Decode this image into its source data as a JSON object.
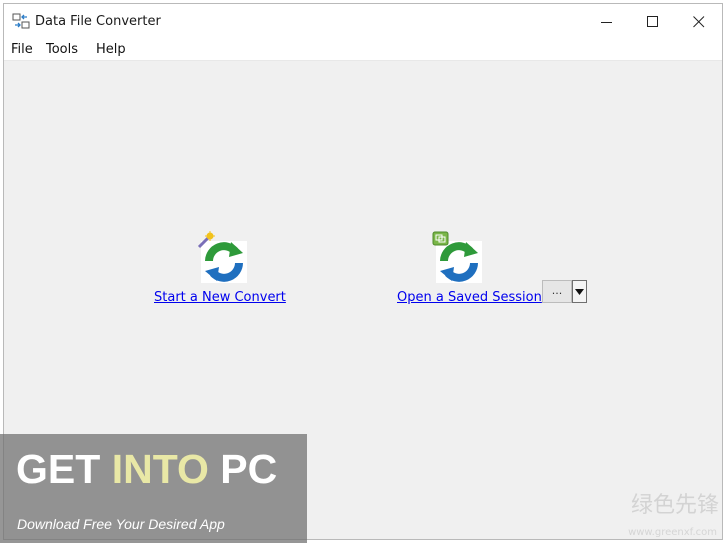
{
  "window": {
    "title": "Data File Converter",
    "controls": {
      "minimize": "minimize",
      "maximize": "maximize",
      "close": "close"
    }
  },
  "menu": {
    "items": [
      {
        "label": "File"
      },
      {
        "label": "Tools"
      },
      {
        "label": "Help"
      }
    ]
  },
  "actions": {
    "new_convert": {
      "label": "Start a New Convert",
      "icon": "convert-icon"
    },
    "open_session": {
      "label": "Open a Saved Session",
      "icon": "session-icon",
      "browse_label": "...",
      "dropdown": "dropdown-arrow"
    }
  },
  "watermark": {
    "main_part1": "GET ",
    "main_part2": "INTO",
    "main_part3": " PC",
    "sub": "Download Free Your Desired App",
    "corner_text": "绿色先锋",
    "corner_url": "www.greenxf.com"
  },
  "colors": {
    "link": "#0000ee",
    "window_bg": "#f0f0f0",
    "watermark_highlight": "#e9e8a6"
  }
}
